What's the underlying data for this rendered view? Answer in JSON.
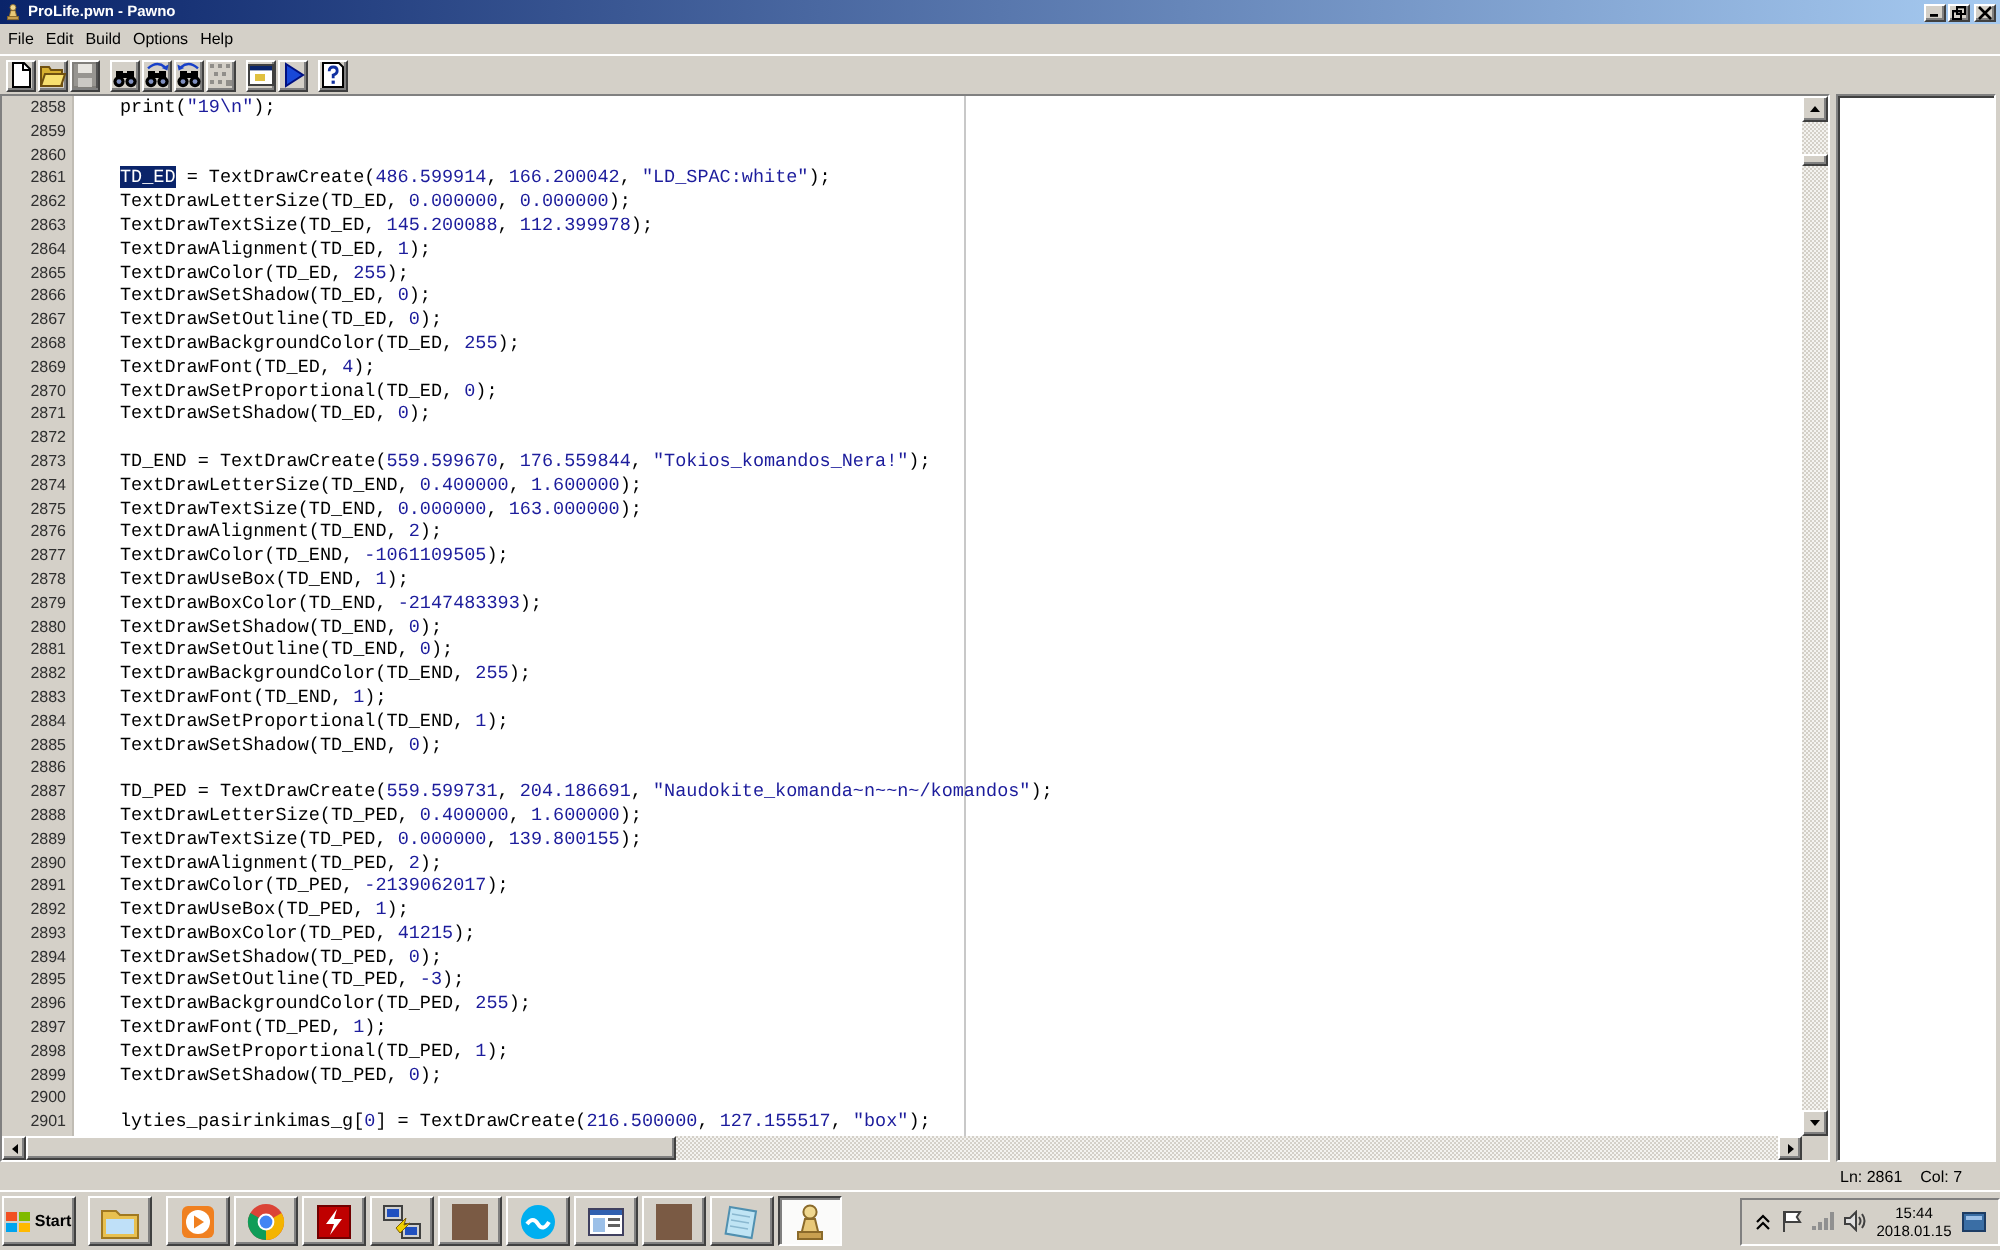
{
  "window": {
    "title": "ProLife.pwn - Pawno"
  },
  "menu": [
    "File",
    "Edit",
    "Build",
    "Options",
    "Help"
  ],
  "toolbar": {
    "groups": [
      [
        {
          "kind": "new",
          "disabled": false
        },
        {
          "kind": "open",
          "disabled": false
        },
        {
          "kind": "save",
          "disabled": true
        }
      ],
      [
        {
          "kind": "find",
          "disabled": false
        },
        {
          "kind": "find-next",
          "disabled": false
        },
        {
          "kind": "replace",
          "disabled": false
        },
        {
          "kind": "goto",
          "disabled": true
        }
      ],
      [
        {
          "kind": "compile",
          "disabled": false
        },
        {
          "kind": "run",
          "disabled": false
        }
      ],
      [
        {
          "kind": "help",
          "disabled": false
        }
      ]
    ]
  },
  "editor": {
    "lines": [
      {
        "number": "2858",
        "parts": [
          {
            "text": "print(\"19\\n\");",
            "selected": false
          }
        ]
      },
      {
        "number": "2859"
      },
      {
        "number": "2860"
      },
      {
        "number": "2861",
        "parts": [
          {
            "text": "TD_ED",
            "selected": true
          },
          {
            "text": " = TextDrawCreate(486.599914, 166.200042, \"LD_SPAC:white\");",
            "selected": false
          }
        ]
      },
      {
        "number": "2862",
        "parts": [
          {
            "text": "TextDrawLetterSize(TD_ED, 0.000000, 0.000000);",
            "selected": false
          }
        ]
      },
      {
        "number": "2863",
        "parts": [
          {
            "text": "TextDrawTextSize(TD_ED, 145.200088, 112.399978);",
            "selected": false
          }
        ]
      },
      {
        "number": "2864",
        "parts": [
          {
            "text": "TextDrawAlignment(TD_ED, 1);",
            "selected": false
          }
        ]
      },
      {
        "number": "2865",
        "parts": [
          {
            "text": "TextDrawColor(TD_ED, 255);",
            "selected": false
          }
        ]
      },
      {
        "number": "2866",
        "parts": [
          {
            "text": "TextDrawSetShadow(TD_ED, 0);",
            "selected": false
          }
        ]
      },
      {
        "number": "2867",
        "parts": [
          {
            "text": "TextDrawSetOutline(TD_ED, 0);",
            "selected": false
          }
        ]
      },
      {
        "number": "2868",
        "parts": [
          {
            "text": "TextDrawBackgroundColor(TD_ED, 255);",
            "selected": false
          }
        ]
      },
      {
        "number": "2869",
        "parts": [
          {
            "text": "TextDrawFont(TD_ED, 4);",
            "selected": false
          }
        ]
      },
      {
        "number": "2870",
        "parts": [
          {
            "text": "TextDrawSetProportional(TD_ED, 0);",
            "selected": false
          }
        ]
      },
      {
        "number": "2871",
        "parts": [
          {
            "text": "TextDrawSetShadow(TD_ED, 0);",
            "selected": false
          }
        ]
      },
      {
        "number": "2872"
      },
      {
        "number": "2873",
        "parts": [
          {
            "text": "TD_END = TextDrawCreate(559.599670, 176.559844, \"Tokios_komandos_Nera!\");",
            "selected": false
          }
        ]
      },
      {
        "number": "2874",
        "parts": [
          {
            "text": "TextDrawLetterSize(TD_END, 0.400000, 1.600000);",
            "selected": false
          }
        ]
      },
      {
        "number": "2875",
        "parts": [
          {
            "text": "TextDrawTextSize(TD_END, 0.000000, 163.000000);",
            "selected": false
          }
        ]
      },
      {
        "number": "2876",
        "parts": [
          {
            "text": "TextDrawAlignment(TD_END, 2);",
            "selected": false
          }
        ]
      },
      {
        "number": "2877",
        "parts": [
          {
            "text": "TextDrawColor(TD_END, -1061109505);",
            "selected": false
          }
        ]
      },
      {
        "number": "2878",
        "parts": [
          {
            "text": "TextDrawUseBox(TD_END, 1);",
            "selected": false
          }
        ]
      },
      {
        "number": "2879",
        "parts": [
          {
            "text": "TextDrawBoxColor(TD_END, -2147483393);",
            "selected": false
          }
        ]
      },
      {
        "number": "2880",
        "parts": [
          {
            "text": "TextDrawSetShadow(TD_END, 0);",
            "selected": false
          }
        ]
      },
      {
        "number": "2881",
        "parts": [
          {
            "text": "TextDrawSetOutline(TD_END, 0);",
            "selected": false
          }
        ]
      },
      {
        "number": "2882",
        "parts": [
          {
            "text": "TextDrawBackgroundColor(TD_END, 255);",
            "selected": false
          }
        ]
      },
      {
        "number": "2883",
        "parts": [
          {
            "text": "TextDrawFont(TD_END, 1);",
            "selected": false
          }
        ]
      },
      {
        "number": "2884",
        "parts": [
          {
            "text": "TextDrawSetProportional(TD_END, 1);",
            "selected": false
          }
        ]
      },
      {
        "number": "2885",
        "parts": [
          {
            "text": "TextDrawSetShadow(TD_END, 0);",
            "selected": false
          }
        ]
      },
      {
        "number": "2886"
      },
      {
        "number": "2887",
        "parts": [
          {
            "text": "TD_PED = TextDrawCreate(559.599731, 204.186691, \"Naudokite_komanda~n~~n~/komandos\");",
            "selected": false
          }
        ]
      },
      {
        "number": "2888",
        "parts": [
          {
            "text": "TextDrawLetterSize(TD_PED, 0.400000, 1.600000);",
            "selected": false
          }
        ]
      },
      {
        "number": "2889",
        "parts": [
          {
            "text": "TextDrawTextSize(TD_PED, 0.000000, 139.800155);",
            "selected": false
          }
        ]
      },
      {
        "number": "2890",
        "parts": [
          {
            "text": "TextDrawAlignment(TD_PED, 2);",
            "selected": false
          }
        ]
      },
      {
        "number": "2891",
        "parts": [
          {
            "text": "TextDrawColor(TD_PED, -2139062017);",
            "selected": false
          }
        ]
      },
      {
        "number": "2892",
        "parts": [
          {
            "text": "TextDrawUseBox(TD_PED, 1);",
            "selected": false
          }
        ]
      },
      {
        "number": "2893",
        "parts": [
          {
            "text": "TextDrawBoxColor(TD_PED, 41215);",
            "selected": false
          }
        ]
      },
      {
        "number": "2894",
        "parts": [
          {
            "text": "TextDrawSetShadow(TD_PED, 0);",
            "selected": false
          }
        ]
      },
      {
        "number": "2895",
        "parts": [
          {
            "text": "TextDrawSetOutline(TD_PED, -3);",
            "selected": false
          }
        ]
      },
      {
        "number": "2896",
        "parts": [
          {
            "text": "TextDrawBackgroundColor(TD_PED, 255);",
            "selected": false
          }
        ]
      },
      {
        "number": "2897",
        "parts": [
          {
            "text": "TextDrawFont(TD_PED, 1);",
            "selected": false
          }
        ]
      },
      {
        "number": "2898",
        "parts": [
          {
            "text": "TextDrawSetProportional(TD_PED, 1);",
            "selected": false
          }
        ]
      },
      {
        "number": "2899",
        "parts": [
          {
            "text": "TextDrawSetShadow(TD_PED, 0);",
            "selected": false
          }
        ]
      },
      {
        "number": "2900"
      },
      {
        "number": "2901",
        "parts": [
          {
            "text": "lyties_pasirinkimas_g[0] = TextDrawCreate(216.500000, 127.155517, \"box\");",
            "selected": false
          }
        ]
      }
    ]
  },
  "status_bar": {
    "line": "Ln: 2861",
    "column": "Col: 7"
  },
  "taskbar": {
    "start_label": "Start",
    "items": [
      {
        "kind": "folder",
        "selected": false
      },
      {
        "kind": "media",
        "selected": false
      },
      {
        "kind": "browser",
        "selected": false
      },
      {
        "kind": "ftp",
        "selected": false
      },
      {
        "kind": "network",
        "selected": false
      },
      {
        "kind": "picture",
        "selected": false
      },
      {
        "kind": "messenger",
        "selected": false
      },
      {
        "kind": "window",
        "selected": false
      },
      {
        "kind": "picture",
        "selected": false
      },
      {
        "kind": "notepad",
        "selected": false
      },
      {
        "kind": "pawn",
        "selected": true
      }
    ],
    "clock": {
      "time": "15:44",
      "date": "2018.01.15"
    }
  }
}
